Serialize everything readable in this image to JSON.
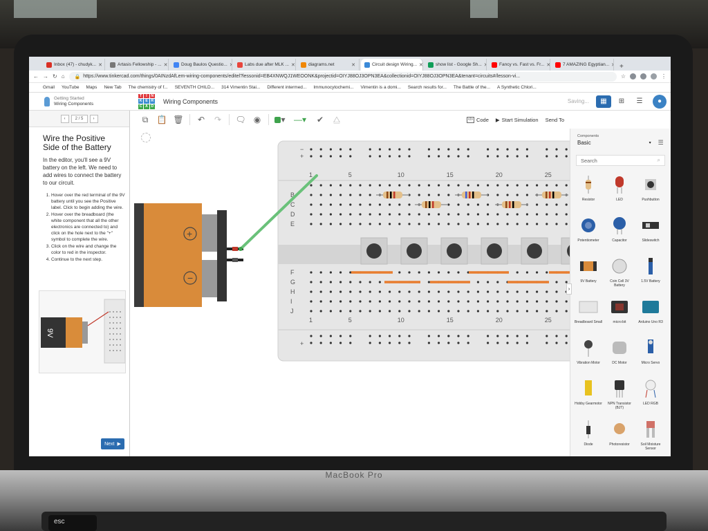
{
  "tabs": [
    {
      "label": "Inbox (47) - chudyk...",
      "color": "#d93025",
      "active": false
    },
    {
      "label": "Artasis Fellowship - ...",
      "color": "#777777",
      "active": false
    },
    {
      "label": "Doug Baulos Questio...",
      "color": "#4285f4",
      "active": false
    },
    {
      "label": "Labs due after MLK ...",
      "color": "#e8453c",
      "active": false
    },
    {
      "label": "diagrams.net",
      "color": "#f08705",
      "active": false
    },
    {
      "label": "Circuit design Wiring...",
      "color": "#3b8ad8",
      "active": true
    },
    {
      "label": "show list - Google Sh...",
      "color": "#0f9d58",
      "active": false
    },
    {
      "label": "Fancy vs. Fast vs. Fr...",
      "color": "#ff0000",
      "active": false
    },
    {
      "label": "7 AMAZING Egyptian...",
      "color": "#ff0000",
      "active": false
    }
  ],
  "address": {
    "url": "https://www.tinkercad.com/things/0AINzdAfLem-wiring-components/editel?lessonid=EB4XNWQJ1WEOONK&projectid=OIYJ88OJ3OPN3EA&collectionid=OIYJ88OJ3OPN3EA&tenant=circuits#/lesson-vi..."
  },
  "bookmarks": [
    "Gmail",
    "YouTube",
    "Maps",
    "New Tab",
    "The chemistry of f...",
    "SEVENTH CHILD...",
    "314 Vimentin Stai...",
    "Different intermed...",
    "Immunocytochemi...",
    "Vimentin is a domi...",
    "Search results for...",
    "The Battle of the...",
    "A Synthetic Chlori..."
  ],
  "header": {
    "getting_started": "Getting Started",
    "lesson_name": "Wiring Components",
    "logo_letters": [
      "T",
      "I",
      "N",
      "K",
      "E",
      "R",
      "C",
      "A",
      "D"
    ],
    "logo_colors": [
      "#e03a3e",
      "#e03a3e",
      "#e03a3e",
      "#3d8fd1",
      "#3d8fd1",
      "#3d8fd1",
      "#3aa84a",
      "#3aa84a",
      "#3aa84a"
    ],
    "title": "Wiring Components",
    "saving": "Saving..."
  },
  "lesson": {
    "pager": "2 / 5",
    "title": "Wire the Positive Side of the Battery",
    "intro": "In the editor, you'll see a 9V battery on the left. We need to add wires to connect the battery to our circuit.",
    "steps": [
      "Hover over the red terminal of the 9V battery until you see the Positive label. Click to begin adding the wire.",
      "Hover over the breadboard (the white component that all the other electronics are connected to) and click on the hole next to the \"+\" symbol to complete the wire.",
      "Click on the wire and change the color to red in the inspector.",
      "Continue to the next step."
    ],
    "thumb_label": "9V",
    "next_label": "Next"
  },
  "toolbar": {
    "code_label": "Code",
    "start_sim_label": "Start Simulation",
    "send_to_label": "Send To",
    "wire_color": "#3fa34d"
  },
  "breadboard": {
    "col_numbers": [
      "1",
      "5",
      "10",
      "15",
      "20",
      "25"
    ],
    "row_letters_top": [
      "B",
      "C",
      "D",
      "E"
    ],
    "row_letters_bottom": [
      "F",
      "G",
      "H",
      "I",
      "J"
    ]
  },
  "battery": {
    "plus_symbol": "+",
    "minus_symbol": "−"
  },
  "components": {
    "header": "Components",
    "category": "Basic",
    "search_placeholder": "Search",
    "items": [
      {
        "label": "Resistor",
        "icon": "resistor-icon"
      },
      {
        "label": "LED",
        "icon": "led-icon"
      },
      {
        "label": "Pushbutton",
        "icon": "pushbutton-icon"
      },
      {
        "label": "Potentiometer",
        "icon": "potentiometer-icon"
      },
      {
        "label": "Capacitor",
        "icon": "capacitor-icon"
      },
      {
        "label": "Slideswitch",
        "icon": "slideswitch-icon"
      },
      {
        "label": "9V Battery",
        "icon": "battery-9v-icon"
      },
      {
        "label": "Coin Cell 3V Battery",
        "icon": "coin-cell-icon"
      },
      {
        "label": "1.5V Battery",
        "icon": "battery-aa-icon"
      },
      {
        "label": "Breadboard Small",
        "icon": "breadboard-icon"
      },
      {
        "label": "micro:bit",
        "icon": "microbit-icon"
      },
      {
        "label": "Arduino Uno R3",
        "icon": "arduino-icon"
      },
      {
        "label": "Vibration Motor",
        "icon": "vibration-motor-icon"
      },
      {
        "label": "DC Motor",
        "icon": "dc-motor-icon"
      },
      {
        "label": "Micro Servo",
        "icon": "micro-servo-icon"
      },
      {
        "label": "Hobby Gearmotor",
        "icon": "gearmotor-icon"
      },
      {
        "label": "NPN Transistor (BJT)",
        "icon": "transistor-icon"
      },
      {
        "label": "LED RGB",
        "icon": "led-rgb-icon"
      },
      {
        "label": "Diode",
        "icon": "diode-icon"
      },
      {
        "label": "Photoresistor",
        "icon": "photoresistor-icon"
      },
      {
        "label": "Soil Moisture Sensor",
        "icon": "soil-sensor-icon"
      }
    ]
  },
  "device": {
    "brand": "MacBook Pro",
    "esc_key": "esc"
  }
}
